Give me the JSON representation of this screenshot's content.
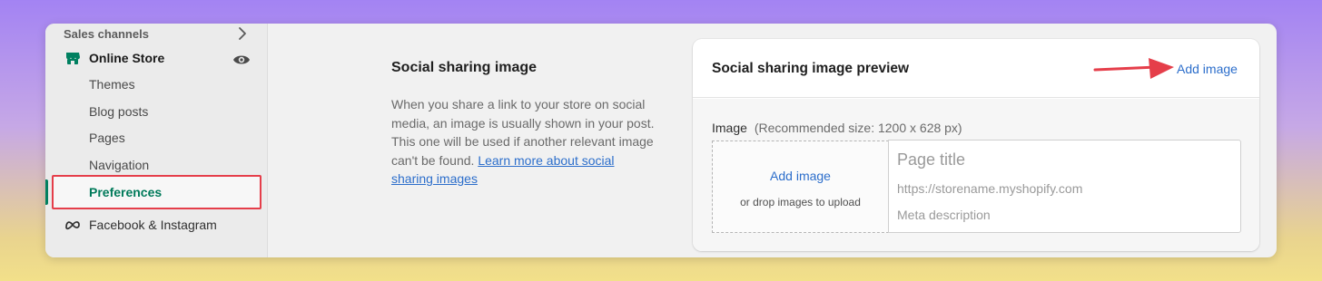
{
  "sidebar": {
    "section_label": "Sales channels",
    "online_store": "Online Store",
    "sub_items": [
      {
        "label": "Themes"
      },
      {
        "label": "Blog posts"
      },
      {
        "label": "Pages"
      },
      {
        "label": "Navigation"
      },
      {
        "label": "Preferences"
      }
    ],
    "facebook": "Facebook & Instagram"
  },
  "section": {
    "title": "Social sharing image",
    "description": "When you share a link to your store on social media, an image is usually shown in your post. This one will be used if another relevant image can't be found.",
    "learn_more": "Learn more about social sharing images"
  },
  "card": {
    "title": "Social sharing image preview",
    "add_image_link": "Add image",
    "image_label": "Image",
    "recommended": "(Recommended size: 1200 x 628 px)",
    "drop_add": "Add image",
    "drop_hint": "or drop images to upload",
    "preview_title": "Page title",
    "preview_url": "https://storename.myshopify.com",
    "preview_meta": "Meta description"
  },
  "colors": {
    "accent_green": "#008060",
    "link_blue": "#2c6ecb",
    "highlight_red": "#e53e4a"
  }
}
